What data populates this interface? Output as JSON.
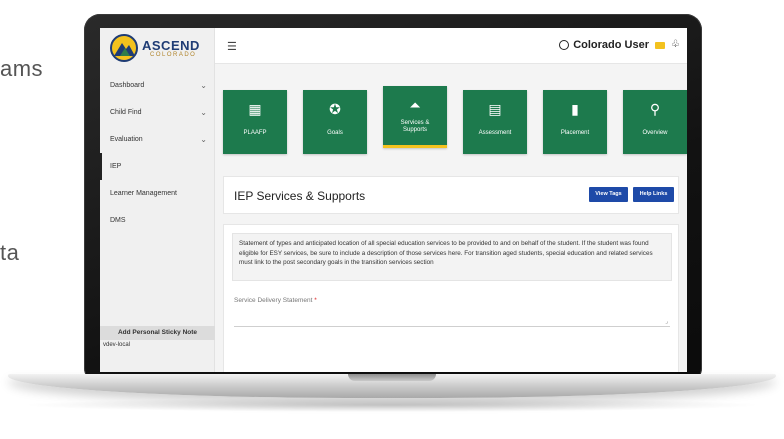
{
  "background": {
    "text_1": "ams",
    "text_2": "ta"
  },
  "header": {
    "logo": {
      "name": "ASCEND",
      "sub": "COLORADO"
    },
    "menu_icon": "hamburger-icon",
    "user_name": "Colorado User"
  },
  "sidebar": {
    "items": [
      {
        "label": "Dashboard",
        "expandable": true
      },
      {
        "label": "Child Find",
        "expandable": true
      },
      {
        "label": "Evaluation",
        "expandable": true
      },
      {
        "label": "IEP",
        "expandable": false,
        "active": true
      },
      {
        "label": "Learner Management",
        "expandable": false
      },
      {
        "label": "DMS",
        "expandable": false
      }
    ],
    "sticky_note_button": "Add Personal Sticky Note",
    "environment": "vdev-local"
  },
  "tiles": [
    {
      "label": "PLAAFP",
      "icon": "dashboard-grid-icon"
    },
    {
      "label": "Goals",
      "icon": "star-badge-icon"
    },
    {
      "label": "Services &\nSupports",
      "icon": "cloche-icon",
      "active": true
    },
    {
      "label": "Assessment",
      "icon": "bar-chart-icon"
    },
    {
      "label": "Placement",
      "icon": "book-icon"
    },
    {
      "label": "Overview",
      "icon": "magnifier-icon"
    }
  ],
  "panel": {
    "title": "IEP Services & Supports",
    "view_tags_button": "View Tags",
    "help_links_button": "Help Links"
  },
  "content": {
    "statement": "Statement of types and anticipated location of all special education services to be provided to and on behalf of the student. If the student was found eligible for ESY services, be sure to include a description of those services here. For transition aged students, special education and related services must link to the post secondary goals in the transition services section",
    "field_label": "Service Delivery Statement",
    "required_marker": "*"
  },
  "colors": {
    "tile_green": "#1d7a4d",
    "active_underline": "#f3c21e",
    "button_blue": "#1e4aa8",
    "logo_navy": "#1f3c74"
  }
}
